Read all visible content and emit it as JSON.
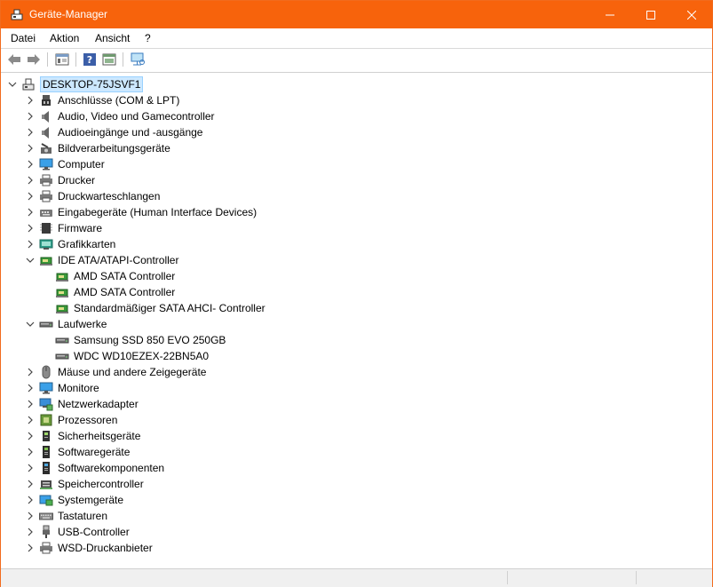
{
  "window": {
    "title": "Geräte-Manager",
    "accent": "#f7630c"
  },
  "menu": [
    "Datei",
    "Aktion",
    "Ansicht",
    "?"
  ],
  "toolbar": {
    "buttons": [
      "back-icon",
      "forward-icon",
      "properties-icon",
      "help-icon",
      "update-driver-icon",
      "scan-hardware-icon"
    ]
  },
  "tree": {
    "root": "DESKTOP-75JSVF1",
    "items": [
      {
        "label": "Anschlüsse (COM & LPT)",
        "icon": "port-icon",
        "expanded": false
      },
      {
        "label": "Audio, Video und Gamecontroller",
        "icon": "speaker-icon",
        "expanded": false
      },
      {
        "label": "Audioeingänge und -ausgänge",
        "icon": "speaker-icon",
        "expanded": false
      },
      {
        "label": "Bildverarbeitungsgeräte",
        "icon": "camera-icon",
        "expanded": false
      },
      {
        "label": "Computer",
        "icon": "monitor-icon",
        "expanded": false
      },
      {
        "label": "Drucker",
        "icon": "printer-icon",
        "expanded": false
      },
      {
        "label": "Druckwarteschlangen",
        "icon": "printer-icon",
        "expanded": false
      },
      {
        "label": "Eingabegeräte (Human Interface Devices)",
        "icon": "hid-icon",
        "expanded": false
      },
      {
        "label": "Firmware",
        "icon": "chip-icon",
        "expanded": false
      },
      {
        "label": "Grafikkarten",
        "icon": "display-adapter-icon",
        "expanded": false
      },
      {
        "label": "IDE ATA/ATAPI-Controller",
        "icon": "controller-icon",
        "expanded": true
      },
      {
        "label": "AMD SATA Controller",
        "icon": "controller-icon",
        "child": true
      },
      {
        "label": "AMD SATA Controller",
        "icon": "controller-icon",
        "child": true
      },
      {
        "label": "Standardmäßiger SATA AHCI- Controller",
        "icon": "controller-icon",
        "child": true
      },
      {
        "label": "Laufwerke",
        "icon": "drive-icon",
        "expanded": true
      },
      {
        "label": "Samsung SSD 850 EVO 250GB",
        "icon": "drive-icon",
        "child": true
      },
      {
        "label": "WDC WD10EZEX-22BN5A0",
        "icon": "drive-icon",
        "child": true
      },
      {
        "label": "Mäuse und andere Zeigegeräte",
        "icon": "mouse-icon",
        "expanded": false
      },
      {
        "label": "Monitore",
        "icon": "monitor-icon",
        "expanded": false
      },
      {
        "label": "Netzwerkadapter",
        "icon": "network-icon",
        "expanded": false
      },
      {
        "label": "Prozessoren",
        "icon": "cpu-icon",
        "expanded": false
      },
      {
        "label": "Sicherheitsgeräte",
        "icon": "security-icon",
        "expanded": false
      },
      {
        "label": "Softwaregeräte",
        "icon": "software-device-icon",
        "expanded": false
      },
      {
        "label": "Softwarekomponenten",
        "icon": "software-component-icon",
        "expanded": false
      },
      {
        "label": "Speichercontroller",
        "icon": "storage-controller-icon",
        "expanded": false
      },
      {
        "label": "Systemgeräte",
        "icon": "system-folder-icon",
        "expanded": false
      },
      {
        "label": "Tastaturen",
        "icon": "keyboard-icon",
        "expanded": false
      },
      {
        "label": "USB-Controller",
        "icon": "usb-icon",
        "expanded": false
      },
      {
        "label": "WSD-Druckanbieter",
        "icon": "printer-icon",
        "expanded": false
      }
    ]
  }
}
